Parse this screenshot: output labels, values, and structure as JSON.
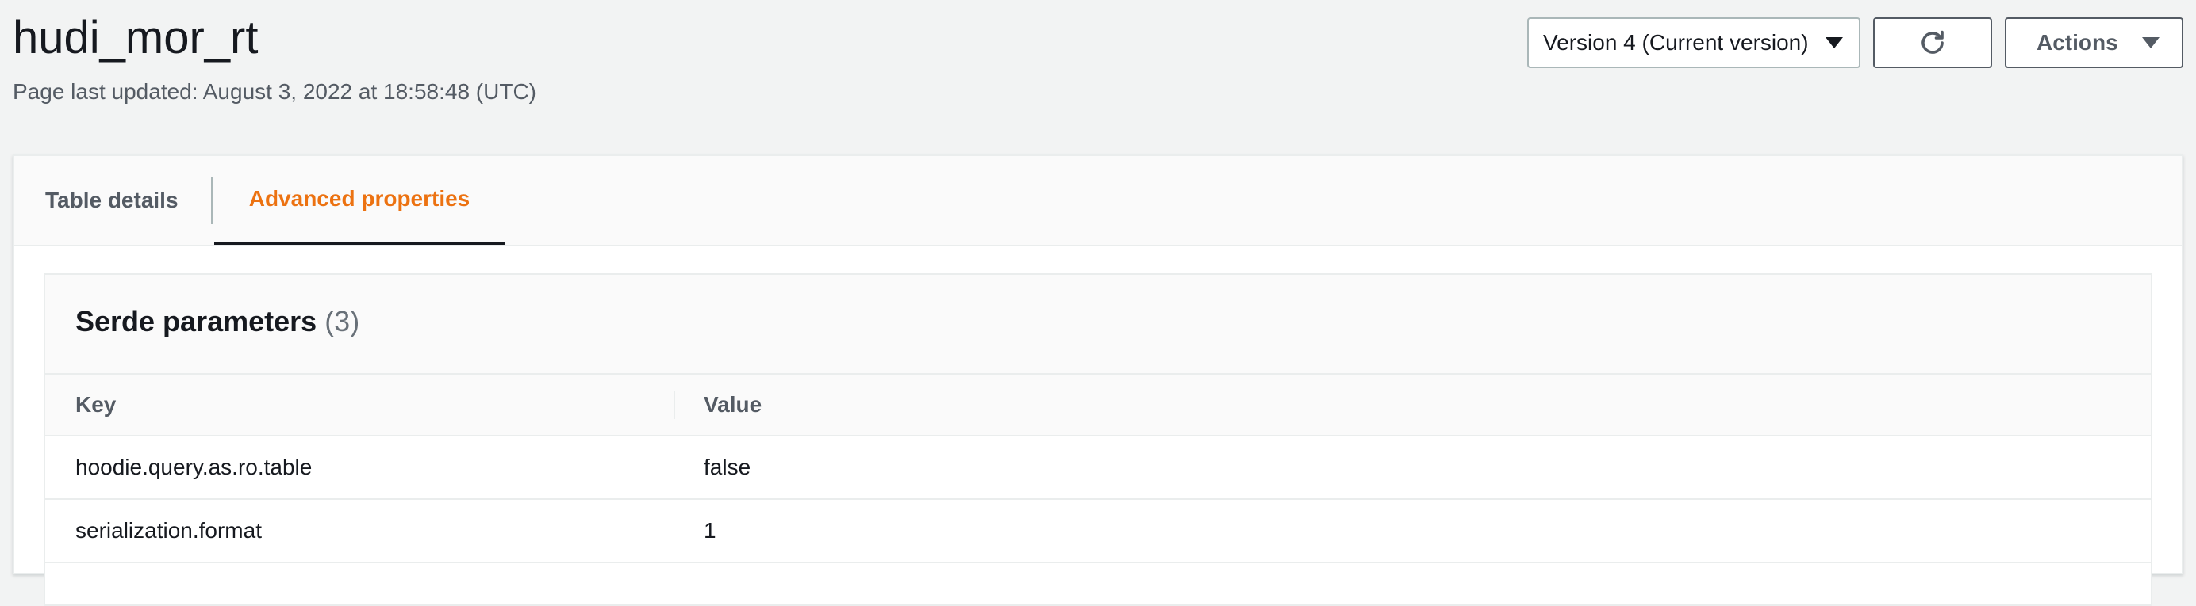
{
  "header": {
    "title": "hudi_mor_rt",
    "subtitle": "Page last updated: August 3, 2022 at 18:58:48 (UTC)",
    "version_select": "Version 4 (Current version)",
    "refresh_icon": "refresh-icon",
    "actions_label": "Actions"
  },
  "tabs": [
    {
      "label": "Table details",
      "active": false
    },
    {
      "label": "Advanced properties",
      "active": true
    }
  ],
  "section": {
    "title": "Serde parameters",
    "count": "(3)"
  },
  "table": {
    "columns": [
      "Key",
      "Value"
    ],
    "rows": [
      {
        "key": "hoodie.query.as.ro.table",
        "value": "false"
      },
      {
        "key": "serialization.format",
        "value": "1"
      }
    ]
  },
  "colors": {
    "accent": "#ec7211",
    "background": "#f2f3f3",
    "text": "#16191f",
    "muted": "#545b64"
  }
}
